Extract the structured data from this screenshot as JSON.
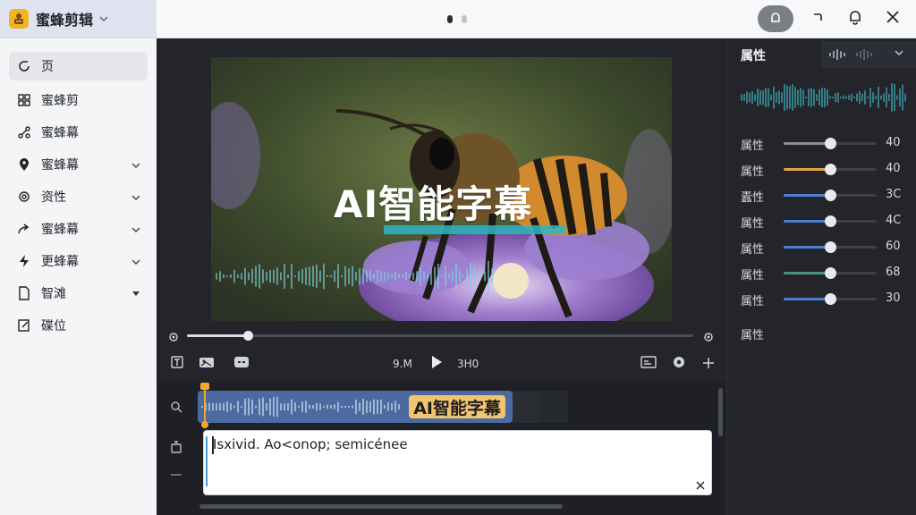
{
  "app": {
    "title": "蜜蜂剪辑"
  },
  "sidebar": {
    "items": [
      {
        "label": "页",
        "icon": "refresh-icon",
        "active": true,
        "chevron": false
      },
      {
        "label": "蜜蜂剪",
        "icon": "grid-icon",
        "chevron": false
      },
      {
        "label": "蜜蜂幕",
        "icon": "nodes-icon",
        "chevron": false
      },
      {
        "label": "蜜蜂幕",
        "icon": "location-pin-icon",
        "chevron": true
      },
      {
        "label": "资性",
        "icon": "gear-icon",
        "chevron": true
      },
      {
        "label": "蜜蜂幕",
        "icon": "share-arrow-icon",
        "chevron": true
      },
      {
        "label": "更蜂幕",
        "icon": "lightning-icon",
        "chevron": true
      },
      {
        "label": "智滩",
        "icon": "document-icon",
        "chevron": true,
        "chevron_style": "filled"
      },
      {
        "label": "碟位",
        "icon": "edit-icon",
        "chevron": false
      }
    ]
  },
  "topbar": {
    "page_dots": [
      {
        "active": true
      },
      {
        "active": false
      }
    ]
  },
  "preview": {
    "subtitle_text": "AI智能字幕",
    "progress": 0.12
  },
  "player": {
    "current_time": "9.M",
    "total_time": "3H0"
  },
  "timeline": {
    "clip_label": "AI智能字幕",
    "editor_text": "Ιsxivid. Ao<onop; semicénee"
  },
  "panel": {
    "title": "属性",
    "properties": [
      {
        "label": "属性",
        "value": "40",
        "level": 0.5,
        "color": "#8a8d94"
      },
      {
        "label": "属性",
        "value": "40",
        "level": 0.5,
        "color": "#e3a546"
      },
      {
        "label": "蠹性",
        "value": "3C",
        "level": 0.5,
        "color": "#4d7fd1"
      },
      {
        "label": "属性",
        "value": "4C",
        "level": 0.5,
        "color": "#4d7fd1"
      },
      {
        "label": "属性",
        "value": "60",
        "level": 0.5,
        "color": "#4d7fd1"
      },
      {
        "label": "属性",
        "value": "68",
        "level": 0.5,
        "color": "#4f8f7a"
      },
      {
        "label": "属性",
        "value": "30",
        "level": 0.5,
        "color": "#4d7fd1"
      }
    ],
    "footer_label": "属性"
  },
  "colors": {
    "accent_teal": "#2fb5c5",
    "clip_blue": "#4a6aa0",
    "playhead": "#f4a92a",
    "clip_label_bg": "#f2c46f"
  }
}
